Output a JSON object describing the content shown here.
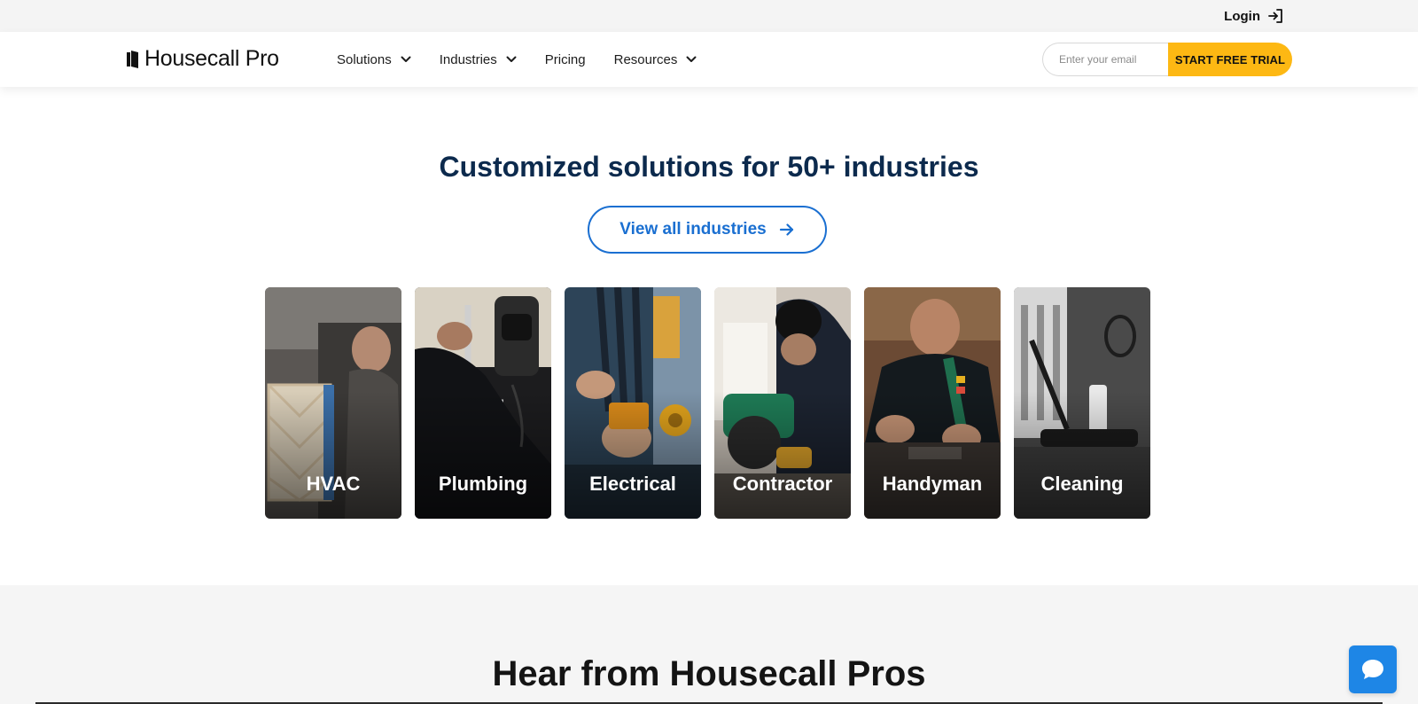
{
  "topbar": {
    "login_label": "Login",
    "login_icon": "login-arrow-icon"
  },
  "header": {
    "logo_text": "Housecall Pro",
    "nav": [
      {
        "label": "Solutions",
        "has_dropdown": true
      },
      {
        "label": "Industries",
        "has_dropdown": true
      },
      {
        "label": "Pricing",
        "has_dropdown": false
      },
      {
        "label": "Resources",
        "has_dropdown": true
      }
    ],
    "email_placeholder": "Enter your email",
    "email_value": "",
    "cta_label": "START FREE TRIAL"
  },
  "industries": {
    "title": "Customized solutions for 50+ industries",
    "view_all_label": "View all industries",
    "cards": [
      {
        "label": "HVAC"
      },
      {
        "label": "Plumbing"
      },
      {
        "label": "Electrical"
      },
      {
        "label": "Contractor"
      },
      {
        "label": "Handyman"
      },
      {
        "label": "Cleaning"
      }
    ]
  },
  "testimonials": {
    "title": "Hear from Housecall Pros"
  },
  "chat": {
    "icon": "chat-bubble-icon"
  },
  "colors": {
    "accent_yellow": "#fdb813",
    "link_blue": "#1a6fd1",
    "heading_navy": "#0c2a4d",
    "chat_blue": "#1e86e6"
  }
}
